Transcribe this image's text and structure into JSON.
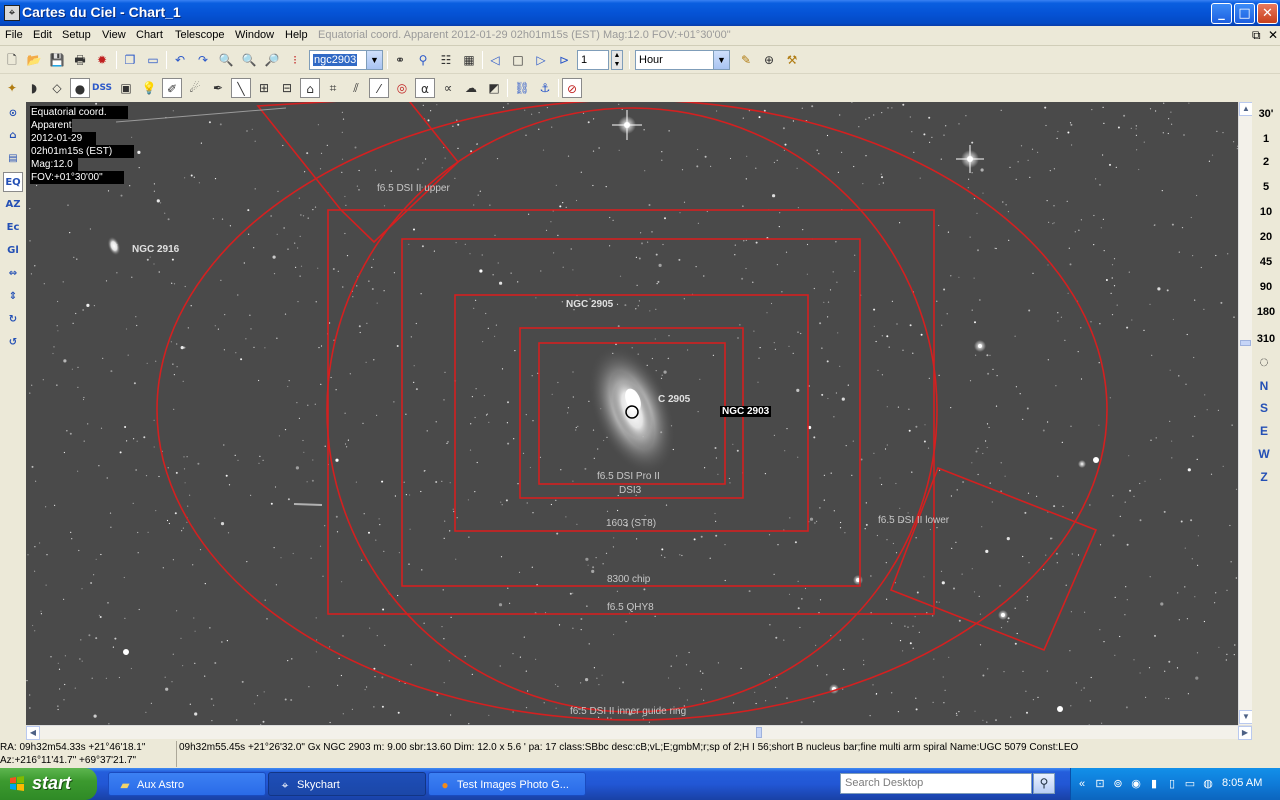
{
  "window": {
    "title": "Cartes du Ciel - Chart_1",
    "app_icon": "compass-icon",
    "minimize": "_",
    "maximize": "□",
    "close": "✕"
  },
  "menu": {
    "items": [
      "File",
      "Edit",
      "Setup",
      "View",
      "Chart",
      "Telescope",
      "Window",
      "Help"
    ],
    "status": "Equatorial coord. Apparent 2012-01-29 02h01m15s (EST) Mag:12.0 FOV:+01°30'00\""
  },
  "toolbar1": {
    "search_value": "ngc2903",
    "step_value": "1",
    "time_unit": "Hour"
  },
  "toolbar2": {
    "dss_label": "DSS",
    "alpha_label": "α"
  },
  "left_tools": [
    "EQ",
    "AZ",
    "Ec",
    "Gl"
  ],
  "chart": {
    "info": {
      "line1": "Equatorial coord.",
      "line2": "Apparent",
      "line3": "2012-01-29",
      "line4": "02h01m15s (EST)",
      "line5": "Mag:12.0",
      "line6": "FOV:+01°30'00\""
    },
    "objects": {
      "ngc2916": "NGC 2916",
      "ngc2905a": "NGC 2905",
      "ngc2905b": "C 2905",
      "ngc2903": "NGC 2903"
    },
    "fov_frames": {
      "dsi_upper": "f6.5 DSI II upper",
      "dsi_pro": "f6.5 DSI Pro II",
      "dsi3": "DSI3",
      "st8": "1603 (ST8)",
      "chip8300": "8300 chip",
      "qhy8": "f6.5 QHY8",
      "dsi_lower": "f6.5 DSI II lower",
      "guide_ring": "f6.5 DSI II inner guide ring"
    }
  },
  "zoom_levels": [
    "30'",
    "1",
    "2",
    "5",
    "10",
    "20",
    "45",
    "90",
    "180",
    "310"
  ],
  "directions": [
    "N",
    "S",
    "E",
    "W",
    "Z"
  ],
  "status": {
    "ra": "RA: 09h32m54.33s +21°46'18.1\"",
    "az": "Az:+216°11'41.7\" +69°37'21.7\"",
    "detail": "09h32m55.45s +21°26'32.0\" Gx NGC 2903 m: 9.00 sbr:13.60 Dim: 12.0 x 5.6 ' pa: 17 class:SBbc desc:cB;vL;E;gmbM;r;sp of 2;H I 56;short B nucleus bar;fine multi arm spiral Name:UGC 5079 Const:LEO"
  },
  "taskbar": {
    "start": "start",
    "tasks": [
      "Aux Astro",
      "Skychart",
      "Test Images Photo G..."
    ],
    "search_placeholder": "Search Desktop",
    "clock": "8:05 AM"
  }
}
